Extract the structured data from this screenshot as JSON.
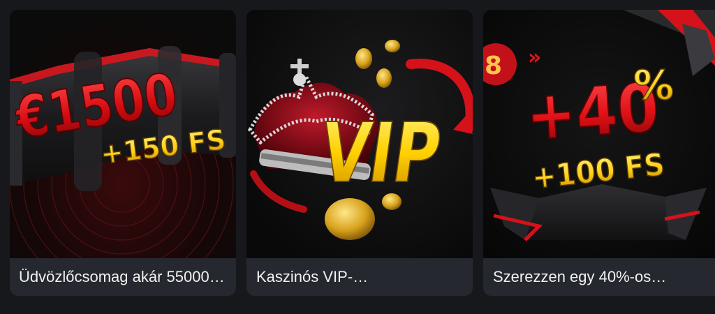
{
  "promotions": [
    {
      "headline": "€1500",
      "subline": "+150 FS",
      "caption": "Üdvözlőcsomag akár 55000…"
    },
    {
      "headline": "VIP",
      "caption": "Kaszinós VIP-…"
    },
    {
      "headline": "+40",
      "headline_suffix": "%",
      "subline": "+100 FS",
      "badge": "8",
      "chevrons": "»",
      "caption": "Szerezzen egy 40%-os…"
    }
  ],
  "colors": {
    "accent_red": "#e0141b",
    "accent_gold": "#ffd21a",
    "card_caption_bg": "#25282e",
    "page_bg": "#16181c"
  }
}
